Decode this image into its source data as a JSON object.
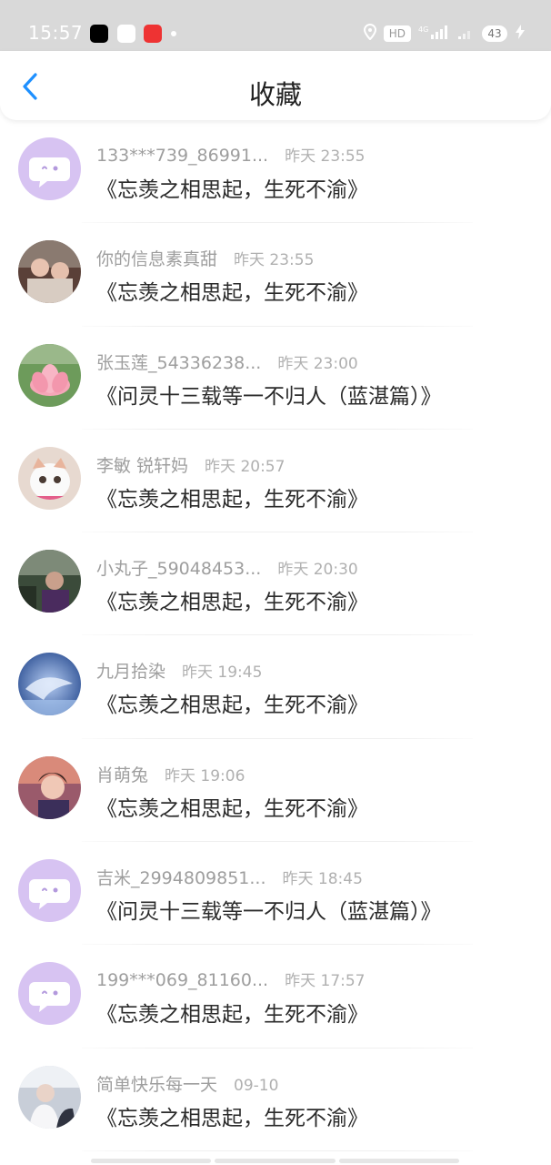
{
  "status_bar": {
    "time": "15:57",
    "hd": "HD",
    "network": "4G",
    "battery": "43"
  },
  "header": {
    "title": "收藏"
  },
  "items": [
    {
      "name": "133***739_86991...",
      "time": "昨天 23:55",
      "content": "《忘羡之相思起，生死不渝》",
      "avatar": "default-avatar"
    },
    {
      "name": "你的信息素真甜",
      "time": "昨天 23:55",
      "content": "《忘羡之相思起，生死不渝》",
      "avatar": "photo-avatar"
    },
    {
      "name": "张玉莲_54336238...",
      "time": "昨天 23:00",
      "content": "《问灵十三载等一不归人（蓝湛篇）》",
      "avatar": "lotus-avatar"
    },
    {
      "name": "李敏 锐轩妈",
      "time": "昨天 20:57",
      "content": "《忘羡之相思起，生死不渝》",
      "avatar": "cat-avatar"
    },
    {
      "name": "小丸子_59048453...",
      "time": "昨天 20:30",
      "content": "《忘羡之相思起，生死不渝》",
      "avatar": "photo-avatar"
    },
    {
      "name": "九月拾染",
      "time": "昨天 19:45",
      "content": "《忘羡之相思起，生死不渝》",
      "avatar": "blue-avatar"
    },
    {
      "name": "肖萌兔",
      "time": "昨天 19:06",
      "content": "《忘羡之相思起，生死不渝》",
      "avatar": "photo-avatar"
    },
    {
      "name": "吉米_2994809851...",
      "time": "昨天 18:45",
      "content": "《问灵十三载等一不归人（蓝湛篇）》",
      "avatar": "default-avatar"
    },
    {
      "name": "199***069_81160...",
      "time": "昨天 17:57",
      "content": "《忘羡之相思起，生死不渝》",
      "avatar": "default-avatar"
    },
    {
      "name": "简单快乐每一天",
      "time": "09-10",
      "content": "《忘羡之相思起，生死不渝》",
      "avatar": "photo-avatar"
    }
  ]
}
